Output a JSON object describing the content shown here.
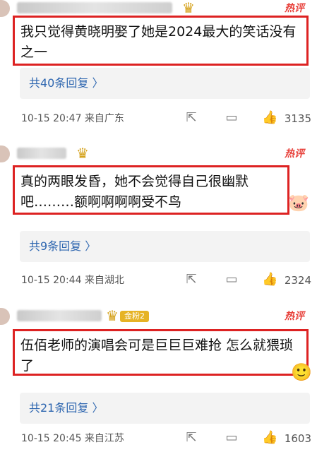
{
  "comments": [
    {
      "hot_label": "热评",
      "text": "我只觉得黄晓明娶了她是2024最大的笑话没有之一",
      "replies": "共40条回复 〉",
      "meta": "10-15 20:47  来自广东",
      "likes": "3135"
    },
    {
      "hot_label": "热评",
      "text": "真的两眼发昏，她不会觉得自己很幽默吧………额啊啊啊啊受不鸟",
      "replies": "共9条回复 〉",
      "meta": "10-15 20:44  来自湖北",
      "likes": "2324"
    },
    {
      "hot_label": "热评",
      "fan_badge": "金粉2",
      "text": "伍佰老师的演唱会可是巨巨巨难抢 怎么就猥琐了",
      "replies": "共21条回复 〉",
      "meta": "10-15 20:45  来自江苏",
      "likes": "1603"
    }
  ],
  "icons": {
    "share": "share-icon",
    "comment": "comment-icon",
    "like": "thumbs-up-icon",
    "crown": "crown-icon",
    "sticker": "pig-sticker-icon"
  },
  "colors": {
    "highlight_border": "#dd2222",
    "reply_link": "#2f67b0",
    "hot_label": "#e8433d"
  }
}
